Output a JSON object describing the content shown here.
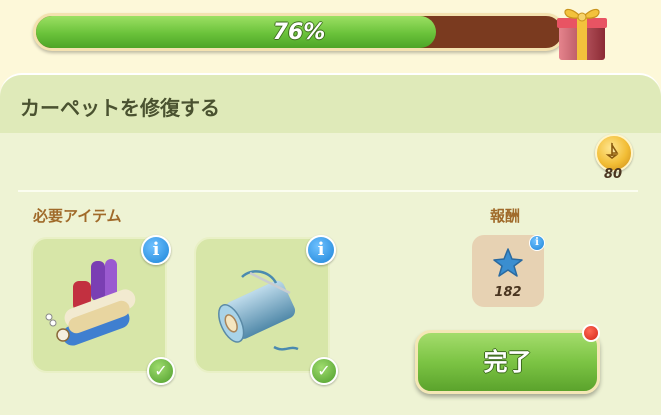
{
  "progress": {
    "label": "76%",
    "fraction": 0.76
  },
  "panel": {
    "title": "カーペットを修復する",
    "coin_reward": "80"
  },
  "required": {
    "label": "必要アイテム",
    "items": [
      {
        "name": "fabric-rolls",
        "completed": true
      },
      {
        "name": "thread-spool",
        "completed": true
      }
    ]
  },
  "reward": {
    "label": "報酬",
    "value": "182",
    "icon": "blue-star-icon"
  },
  "complete_button": {
    "label": "完了"
  },
  "colors": {
    "progress_fill": "#6ac23a",
    "progress_track": "#7a3a1f",
    "panel_bg": "#eef3d4",
    "accent_label": "#a06a2a"
  }
}
